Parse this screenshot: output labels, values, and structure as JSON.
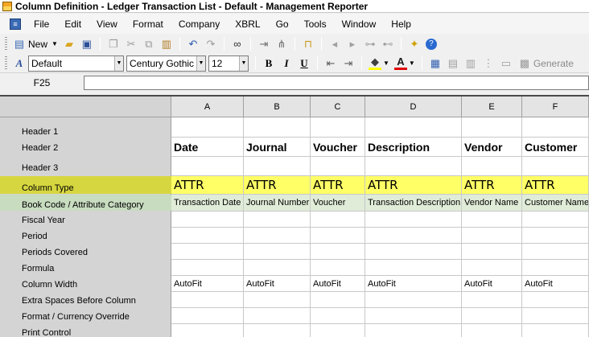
{
  "window": {
    "title": "Column Definition - Ledger Transaction List - Default - Management Reporter"
  },
  "menu": {
    "items": [
      "File",
      "Edit",
      "View",
      "Format",
      "Company",
      "XBRL",
      "Go",
      "Tools",
      "Window",
      "Help"
    ]
  },
  "toolbar": {
    "new_label": "New",
    "generate_label": "Generate"
  },
  "format_toolbar": {
    "style_value": "Default",
    "font_value": "Century Gothic",
    "size_value": "12",
    "bold_label": "B",
    "italic_label": "I",
    "underline_label": "U",
    "font_color": "#e00000",
    "fill_color": "#ffff00"
  },
  "formula_bar": {
    "cell_reference": "F25",
    "value": ""
  },
  "grid": {
    "columns": [
      "A",
      "B",
      "C",
      "D",
      "E",
      "F"
    ],
    "row_labels": [
      "Header 1",
      "Header 2",
      "Header 3",
      "Column Type",
      "Book Code / Attribute Category",
      "Fiscal Year",
      "Period",
      "Periods Covered",
      "Formula",
      "Column Width",
      "Extra Spaces Before Column",
      "Format / Currency Override",
      "Print Control"
    ],
    "header2": [
      "Date",
      "Journal",
      "Voucher",
      "Description",
      "Vendor",
      "Customer"
    ],
    "column_type": [
      "ATTR",
      "ATTR",
      "ATTR",
      "ATTR",
      "ATTR",
      "ATTR"
    ],
    "book_code": [
      "Transaction Date",
      "Journal Number",
      "Voucher",
      "Transaction Description",
      "Vendor Name",
      "Customer Name"
    ],
    "column_width": [
      "AutoFit",
      "AutoFit",
      "AutoFit",
      "AutoFit",
      "AutoFit",
      "AutoFit"
    ],
    "highlight_colors": {
      "column_type": "#ffff66",
      "column_type_label": "#d6d640",
      "book_code": "#e0ecd8",
      "book_code_label": "#c8dcc0"
    }
  }
}
